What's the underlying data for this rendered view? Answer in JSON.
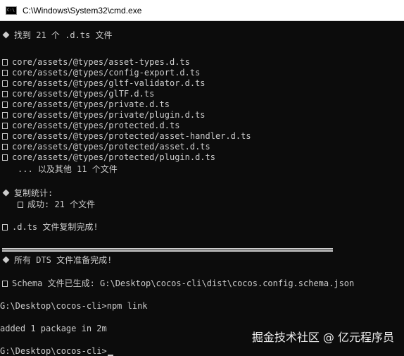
{
  "window": {
    "title": "C:\\Windows\\System32\\cmd.exe",
    "icon": "cmd-icon"
  },
  "console": {
    "found_header": "找到 21 个 .d.ts 文件",
    "files": [
      "core/assets/@types/asset-types.d.ts",
      "core/assets/@types/config-export.d.ts",
      "core/assets/@types/gltf-validator.d.ts",
      "core/assets/@types/glTF.d.ts",
      "core/assets/@types/private.d.ts",
      "core/assets/@types/private/plugin.d.ts",
      "core/assets/@types/protected.d.ts",
      "core/assets/@types/protected/asset-handler.d.ts",
      "core/assets/@types/protected/asset.d.ts",
      "core/assets/@types/protected/plugin.d.ts"
    ],
    "more_files": "... 以及其他 11 个文件",
    "stats_header": "复制统计:",
    "stats_success": "成功: 21 个文件",
    "copy_done": ".d.ts 文件复制完成!",
    "divider": "==========================================================",
    "dts_ready": "所有 DTS 文件准备完成!",
    "schema_done": "Schema 文件已生成: G:\\Desktop\\cocos-cli\\dist\\cocos.config.schema.json",
    "prompt_command": "G:\\Desktop\\cocos-cli>npm link",
    "npm_output": "added 1 package in 2m",
    "prompt_current": "G:\\Desktop\\cocos-cli>"
  },
  "watermark": "掘金技术社区 @ 亿元程序员"
}
